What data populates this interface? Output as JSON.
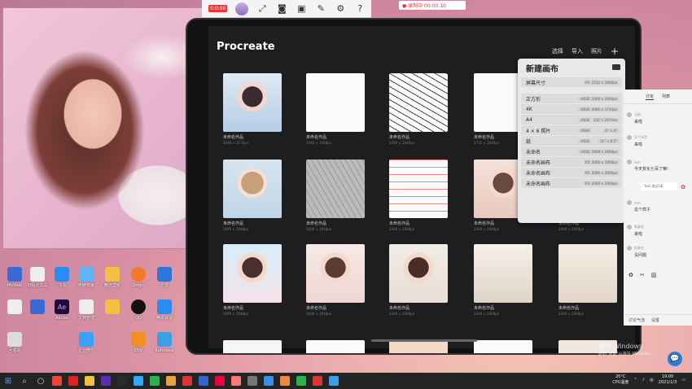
{
  "top_toolbar": {
    "badge": "0:0:00",
    "icons": [
      "avatar-icon",
      "expand-icon",
      "camera-icon",
      "record-icon",
      "pen-icon",
      "settings-icon",
      "help-icon"
    ]
  },
  "recording": {
    "label": "● 录制中 00:00:10"
  },
  "procreate": {
    "title": "Procreate",
    "actions": {
      "select": "选择",
      "import": "导入",
      "photo": "照片",
      "add": "+"
    },
    "artworks": [
      {
        "name": "未命名作品",
        "size": "2048 × 2174px"
      },
      {
        "name": "未命名作品",
        "size": "2048 × 2048px"
      },
      {
        "name": "未命名作品",
        "size": "2048 × 2048px"
      },
      {
        "name": "未命名作品",
        "size": "2732 × 2048px"
      },
      {
        "name": "未命名作品",
        "size": "2048 × 2048px"
      },
      {
        "name": "未命名作品",
        "size": "2048 × 2048px"
      },
      {
        "name": "未命名作品",
        "size": "2048 × 2048px"
      },
      {
        "name": "未命名作品",
        "size": "2048 × 2048px"
      },
      {
        "name": "未命名作品",
        "size": "2048 × 2048px"
      },
      {
        "name": "未命名作品",
        "size": "2048 × 2048px"
      },
      {
        "name": "未命名作品",
        "size": "2048 × 2048px"
      },
      {
        "name": "未命名作品",
        "size": "2048 × 2048px"
      },
      {
        "name": "未命名作品",
        "size": "2048 × 2048px"
      },
      {
        "name": "未命名作品",
        "size": "2048 × 2048px"
      },
      {
        "name": "未命名作品",
        "size": "2048 × 2048px"
      }
    ]
  },
  "new_canvas": {
    "title": "新建画布",
    "rows": [
      {
        "label": "屏幕尺寸",
        "tag": "P3",
        "value": "2732 × 2048px"
      },
      {
        "label": "正方形",
        "tag": "sRGB",
        "value": "2048 × 2048px"
      },
      {
        "label": "4K",
        "tag": "sRGB",
        "value": "4096 × 1714px"
      },
      {
        "label": "A4",
        "tag": "sRGB",
        "value": "210 × 297mm"
      },
      {
        "label": "4 × 6 照片",
        "tag": "sRGB",
        "value": "6\" × 4\""
      },
      {
        "label": "纸",
        "tag": "sRGB",
        "value": "11\" × 8.5\""
      },
      {
        "label": "未命名",
        "tag": "sRGB",
        "value": "2048 × 2048px"
      },
      {
        "label": "未命名画布",
        "tag": "P3",
        "value": "2000 × 2000px"
      },
      {
        "label": "未命名画布",
        "tag": "P3",
        "value": "2000 × 2000px"
      },
      {
        "label": "未命名画布",
        "tag": "P3",
        "value": "2000 × 2000px"
      }
    ]
  },
  "chat": {
    "tabs": [
      "讨论",
      "列表"
    ],
    "messages": [
      {
        "user": "无敌",
        "text": "来啦"
      },
      {
        "user": "半个知音",
        "text": "来啦"
      },
      {
        "user": "fam",
        "text": "今天变化七百了嘛!"
      },
      {
        "user": "fam",
        "text": "这个样子"
      },
      {
        "user": "陈春花",
        "text": "来啦"
      },
      {
        "user": "陈春花",
        "text": "没问题"
      }
    ],
    "toast": "Yuki 进出1条",
    "footer": {
      "discuss": "讨论气泡",
      "settings": "设置"
    }
  },
  "watermark": {
    "line1": "激活 Windows",
    "line2": "转到\"设置\"以激活 Windows。"
  },
  "desktop_icons": [
    "MyWeb",
    "日程化工具",
    "飞书",
    "电脑管家",
    "精选壁纸",
    "Origin",
    "迅雷",
    "Ae",
    "Adobe",
    "文档管理",
    "QQ",
    "腾讯会议",
    "回收站",
    "企业微信",
    "ENV",
    "Autodesk"
  ],
  "taskbar": {
    "weather": "20°C",
    "weather_sub": "CPU温度",
    "time": "19:00",
    "date": "2021/1/3",
    "lang": "中"
  }
}
